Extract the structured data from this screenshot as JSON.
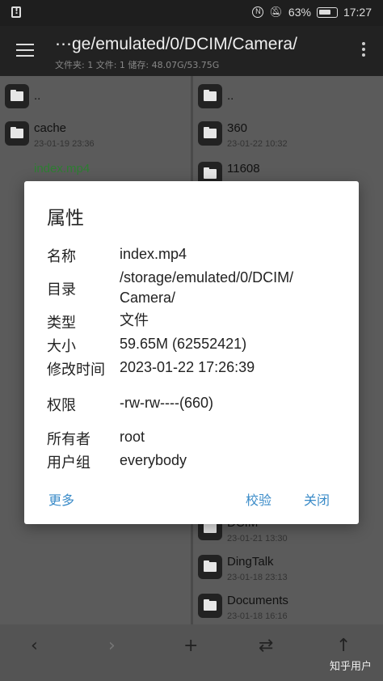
{
  "status": {
    "battery": "63%",
    "time": "17:27"
  },
  "toolbar": {
    "path": "⋯ge/emulated/0/DCIM/Camera/",
    "info": "文件夹: 1   文件: 1   储存: 48.07G/53.75G"
  },
  "left_pane": [
    {
      "name": "..",
      "date": ""
    },
    {
      "name": "cache",
      "date": "23-01-19 23:36"
    },
    {
      "name": "index.mp4",
      "date": ""
    }
  ],
  "right_pane_top": [
    {
      "name": "..",
      "date": ""
    },
    {
      "name": "360",
      "date": "23-01-22 10:32"
    },
    {
      "name": "11608",
      "date": ""
    }
  ],
  "right_pane_bottom": [
    {
      "name": "DCIM",
      "date": "23-01-21 13:30"
    },
    {
      "name": "DingTalk",
      "date": "23-01-18 23:13"
    },
    {
      "name": "Documents",
      "date": "23-01-18 16:16"
    }
  ],
  "dialog": {
    "title": "属性",
    "props": [
      {
        "label": "名称",
        "value": "index.mp4"
      },
      {
        "label": "目录",
        "value": "/storage/emulated/0/DCIM/",
        "value2": "Camera/"
      },
      {
        "label": "类型",
        "value": "文件"
      },
      {
        "label": "大小",
        "value": "59.65M (62552421)"
      },
      {
        "label": "修改时间",
        "value": "2023-01-22 17:26:39"
      },
      {
        "label": "权限",
        "value": "-rw-rw----(660)"
      },
      {
        "label": "所有者",
        "value": "root"
      },
      {
        "label": "用户组",
        "value": "everybody"
      }
    ],
    "buttons": {
      "more": "更多",
      "verify": "校验",
      "close": "关闭"
    }
  },
  "bottom_nav": {
    "back": "‹",
    "forward": "›",
    "add": "+",
    "swap": "⇄",
    "up": "↑"
  },
  "watermark": "知乎用户",
  "colors": {
    "accent": "#3a8bc8",
    "toolbar": "#222222",
    "pane": "#5b5b5b"
  }
}
